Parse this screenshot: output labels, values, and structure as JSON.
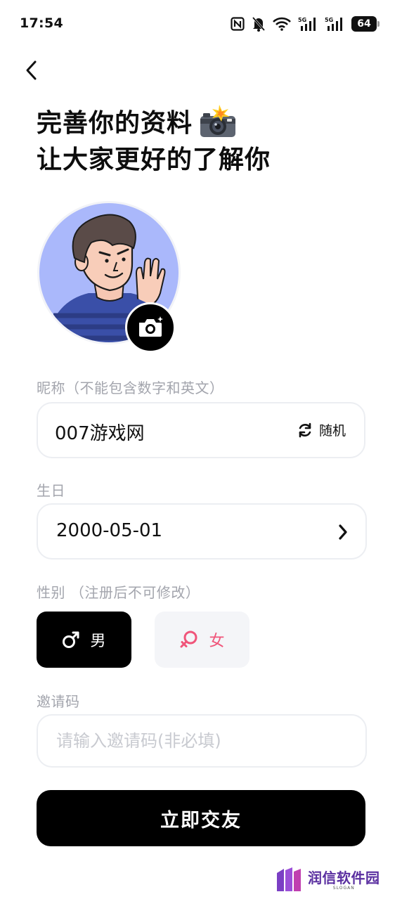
{
  "status_bar": {
    "time": "17:54",
    "battery": "64",
    "icons": [
      "nfc-icon",
      "bell-muted-icon",
      "wifi-icon",
      "signal-5g-1-icon",
      "signal-5g-2-icon",
      "battery-icon"
    ]
  },
  "header": {
    "back_icon": "chevron-left-icon",
    "title_line1": "完善你的资料",
    "title_emoji": "camera-flash-emoji",
    "title_line2": "让大家更好的了解你"
  },
  "avatar": {
    "camera_icon": "camera-icon"
  },
  "nickname": {
    "label": "昵称（不能包含数字和英文）",
    "value": "007游戏网",
    "random_label": "随机",
    "random_icon": "refresh-icon"
  },
  "birthday": {
    "label": "生日",
    "value": "2000-05-01",
    "chevron_icon": "chevron-right-icon"
  },
  "gender": {
    "label": "性别 （注册后不可修改）",
    "male_label": "男",
    "female_label": "女",
    "selected": "男",
    "male_color": "#000000",
    "female_color": "#f0557a"
  },
  "invite": {
    "label": "邀请码",
    "placeholder": "请输入邀请码(非必填)"
  },
  "submit": {
    "label": "立即交友"
  },
  "watermark": {
    "text": "润信软件园",
    "sub": "SLOGAN"
  }
}
